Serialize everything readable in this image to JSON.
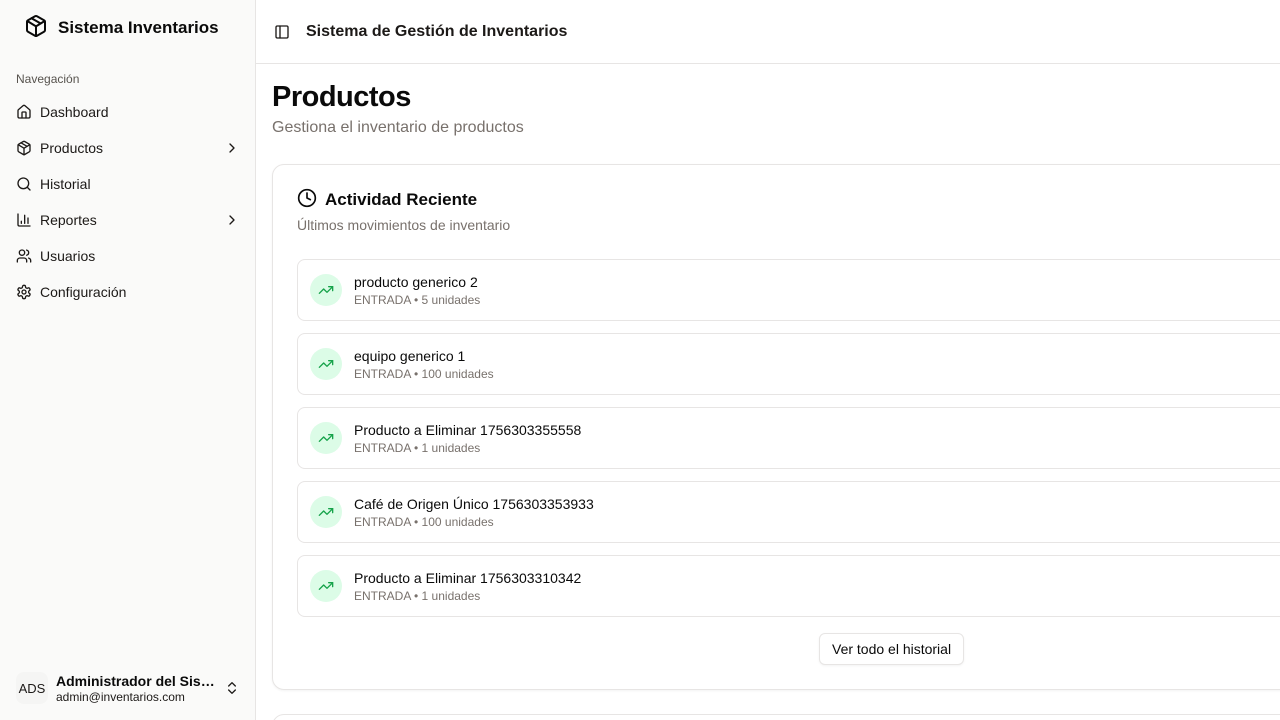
{
  "sidebar": {
    "brand": "Sistema Inventarios",
    "nav_heading": "Navegación",
    "items": [
      {
        "label": "Dashboard",
        "icon": "home-icon",
        "has_submenu": false
      },
      {
        "label": "Productos",
        "icon": "package-icon",
        "has_submenu": true
      },
      {
        "label": "Historial",
        "icon": "search-icon",
        "has_submenu": false
      },
      {
        "label": "Reportes",
        "icon": "bar-chart-icon",
        "has_submenu": true
      },
      {
        "label": "Usuarios",
        "icon": "users-icon",
        "has_submenu": false
      },
      {
        "label": "Configuración",
        "icon": "gear-icon",
        "has_submenu": false
      }
    ],
    "user": {
      "initials": "ADS",
      "name": "Administrador del Sistema",
      "email": "admin@inventarios.com"
    }
  },
  "header": {
    "title": "Sistema de Gestión de Inventarios"
  },
  "main": {
    "title": "Productos",
    "subtitle": "Gestiona el inventario de productos",
    "activity": {
      "title": "Actividad Reciente",
      "description": "Últimos movimientos de inventario",
      "items": [
        {
          "name": "producto generico 2",
          "meta": "ENTRADA • 5 unidades"
        },
        {
          "name": "equipo generico 1",
          "meta": "ENTRADA • 100 unidades"
        },
        {
          "name": "Producto a Eliminar 1756303355558",
          "meta": "ENTRADA • 1 unidades"
        },
        {
          "name": "Café de Origen Único 1756303353933",
          "meta": "ENTRADA • 100 unidades"
        },
        {
          "name": "Producto a Eliminar 1756303310342",
          "meta": "ENTRADA • 1 unidades"
        }
      ],
      "view_all_label": "Ver todo el historial"
    }
  },
  "colors": {
    "accent_green": "#16a34a",
    "green_bg": "#dcfce7",
    "border": "#e7e5e4",
    "muted_text": "#78716c",
    "sidebar_bg": "#fafaf9"
  }
}
